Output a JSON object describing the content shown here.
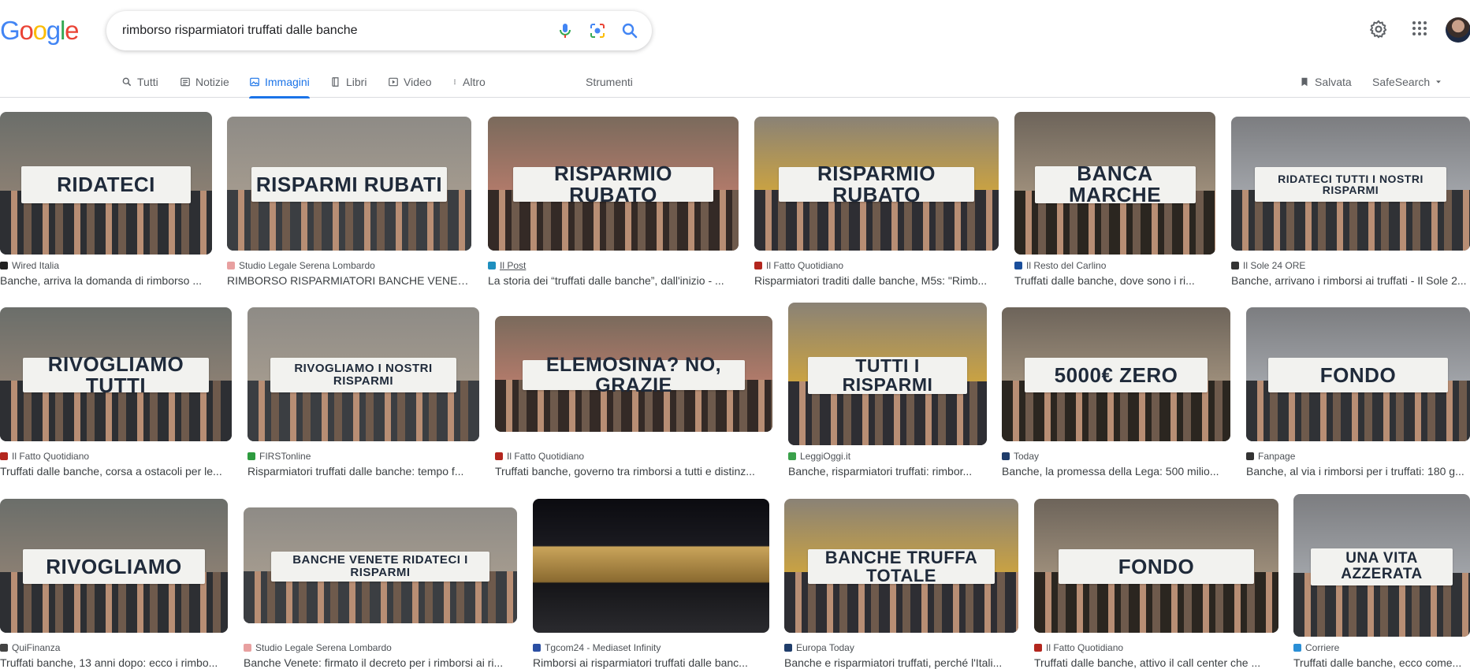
{
  "search": {
    "query": "rimborso risparmiatori truffati dalle banche"
  },
  "tabs": [
    {
      "label": "Tutti",
      "icon": "search-icon"
    },
    {
      "label": "Notizie",
      "icon": "news-icon"
    },
    {
      "label": "Immagini",
      "icon": "image-icon",
      "active": true
    },
    {
      "label": "Libri",
      "icon": "book-icon"
    },
    {
      "label": "Video",
      "icon": "play-icon"
    },
    {
      "label": "Altro",
      "icon": "more-vert-icon"
    }
  ],
  "tools_label": "Strumenti",
  "saved_label": "Salvata",
  "safesearch_label": "SafeSearch",
  "results": [
    [
      {
        "source": "Wired Italia",
        "title": "Banche, arriva la domanda di rimborso ...",
        "banner": "RIDATECI"
      },
      {
        "source": "Studio Legale Serena Lombardo",
        "title": "RIMBORSO RISPARMIATORI BANCHE VENET...",
        "banner": "RISPARMI RUBATI"
      },
      {
        "source": "Il Post",
        "title": "La storia dei “truffati dalle banche”, dall'inizio - ...",
        "banner": "RISPARMIO RUBATO"
      },
      {
        "source": "Il Fatto Quotidiano",
        "title": "Risparmiatori traditi dalle banche, M5s: \"Rimb...",
        "banner": "RISPARMIO RUBATO"
      },
      {
        "source": "Il Resto del Carlino",
        "title": "Truffati dalle banche, dove sono i ri...",
        "banner": "BANCA MARCHE"
      },
      {
        "source": "Il Sole 24 ORE",
        "title": "Banche, arrivano i rimborsi ai truffati - Il Sole 2...",
        "banner": "RIDATECI TUTTI I NOSTRI RISPARMI"
      }
    ],
    [
      {
        "source": "Il Fatto Quotidiano",
        "title": "Truffati dalle banche, corsa a ostacoli per le...",
        "banner": "RIVOGLIAMO TUTTI"
      },
      {
        "source": "FIRSTonline",
        "title": "Risparmiatori truffati dalle banche: tempo f...",
        "banner": "RIVOGLIAMO I NOSTRI RISPARMI"
      },
      {
        "source": "Il Fatto Quotidiano",
        "title": "Truffati banche, governo tra rimborsi a tutti e distinz...",
        "banner": "ELEMOSINA? NO, GRAZIE"
      },
      {
        "source": "LeggiOggi.it",
        "title": "Banche, risparmiatori truffati: rimbor...",
        "banner": "TUTTI I RISPARMI"
      },
      {
        "source": "Today",
        "title": "Banche, la promessa della Lega: 500 milio...",
        "banner": "5000€ ZERO"
      },
      {
        "source": "Fanpage",
        "title": "Banche, al via i rimborsi per i truffati: 180 g...",
        "banner": "FONDO"
      }
    ],
    [
      {
        "source": "QuiFinanza",
        "title": "Truffati banche, 13 anni dopo: ecco i rimbo...",
        "banner": "RIVOGLIAMO"
      },
      {
        "source": "Studio Legale Serena Lombardo",
        "title": "Banche Venete: firmato il decreto per i rimborsi ai ri...",
        "banner": "BANCHE VENETE RIDATECI I RISPARMI"
      },
      {
        "source": "Tgcom24 - Mediaset Infinity",
        "title": "Rimborsi ai risparmiatori truffati dalle banc...",
        "banner": ""
      },
      {
        "source": "Europa Today",
        "title": "Banche e risparmiatori truffati, perché l'Itali...",
        "banner": "BANCHE TRUFFA TOTALE"
      },
      {
        "source": "Il Fatto Quotidiano",
        "title": "Truffati dalle banche, attivo il call center che ...",
        "banner": "FONDO"
      },
      {
        "source": "Corriere",
        "title": "Truffati dalle banche, ecco come...",
        "banner": "UNA VITA AZZERATA"
      }
    ]
  ],
  "colors": {
    "accent": "#1a73e8",
    "favicons": [
      "#222222",
      "#e8a0a0",
      "#1f8fbf",
      "#b3261e",
      "#1a4f9c",
      "#333333",
      "#b3261e",
      "#2e9b3f",
      "#b3261e",
      "#3aa14b",
      "#1f3d6b",
      "#333333",
      "#444444",
      "#e8a0a0",
      "#2b4fa3",
      "#1f3d6b",
      "#b3261e",
      "#2a8fd6"
    ]
  }
}
